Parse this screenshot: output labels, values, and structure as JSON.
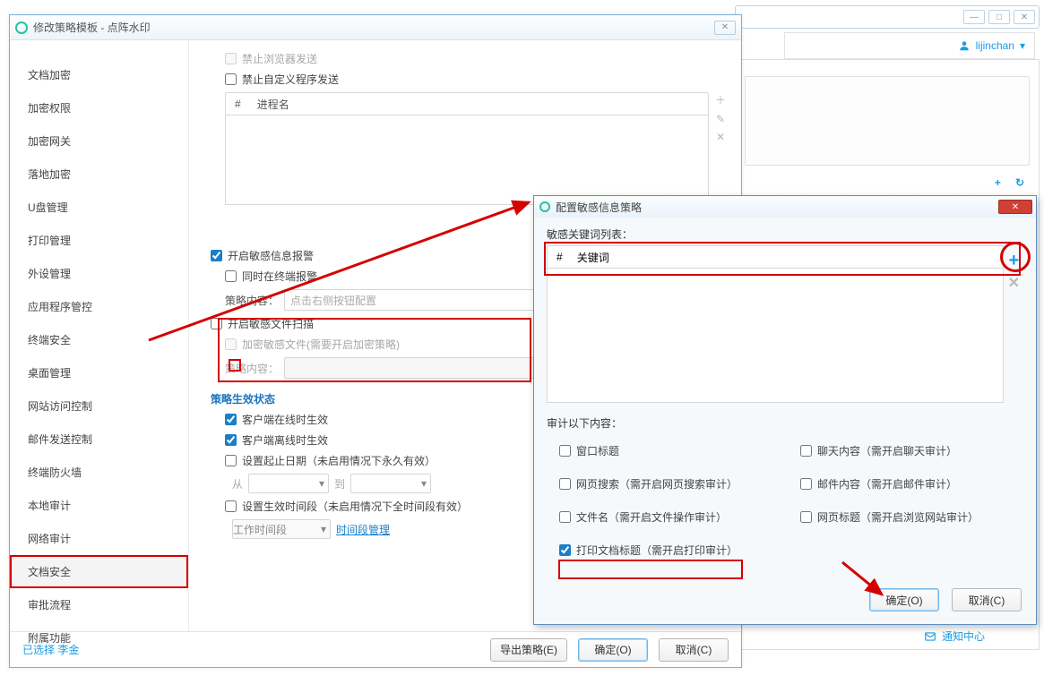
{
  "parent": {
    "user": "lijinchan",
    "add_icon": "+",
    "refresh_icon": "↻",
    "notif": "通知中心"
  },
  "main": {
    "title": "修改策略模板 - 点阵水印",
    "sidebar": [
      "文档加密",
      "加密权限",
      "加密网关",
      "落地加密",
      "U盘管理",
      "打印管理",
      "外设管理",
      "应用程序管控",
      "终端安全",
      "桌面管理",
      "网站访问控制",
      "邮件发送控制",
      "终端防火墙",
      "本地审计",
      "网络审计",
      "文档安全",
      "审批流程",
      "附属功能"
    ],
    "selected_index": 15,
    "top": {
      "cb_browser": "禁止浏览器发送",
      "cb_custom": "禁止自定义程序发送",
      "col_hash": "#",
      "col_proc": "进程名"
    },
    "sens": {
      "cb_alert": "开启敏感信息报警",
      "cb_term": "同时在终端报警",
      "lbl_content": "策略内容：",
      "ph_content": "点击右侧按钮配置",
      "cb_scan": "开启敏感文件扫描",
      "cb_enc": "加密敏感文件(需要开启加密策略)"
    },
    "effect": {
      "heading": "策略生效状态",
      "cb_online": "客户端在线时生效",
      "cb_offline": "客户端离线时生效",
      "cb_date": "设置起止日期（未启用情况下永久有效）",
      "from": "从",
      "to": "到",
      "cb_period": "设置生效时间段（未启用情况下全时间段有效）",
      "sel_period": "工作时间段",
      "link_manage": "时间段管理"
    },
    "footer": {
      "status": "已选择 李金",
      "export": "导出策略(E)",
      "ok": "确定(O)",
      "cancel": "取消(C)"
    }
  },
  "dlg": {
    "title": "配置敏感信息策略",
    "kw_label": "敏感关键词列表：",
    "col_hash": "#",
    "col_kw": "关键词",
    "audit_h": "审计以下内容：",
    "items": {
      "win_title": "窗口标题",
      "chat": "聊天内容（需开启聊天审计）",
      "web_search": "网页搜索（需开启网页搜索审计）",
      "mail": "邮件内容（需开启邮件审计）",
      "filename": "文件名（需开启文件操作审计）",
      "web_title": "网页标题（需开启浏览网站审计）",
      "print": "打印文档标题（需开启打印审计）"
    },
    "ok": "确定(O)",
    "cancel": "取消(C)"
  }
}
